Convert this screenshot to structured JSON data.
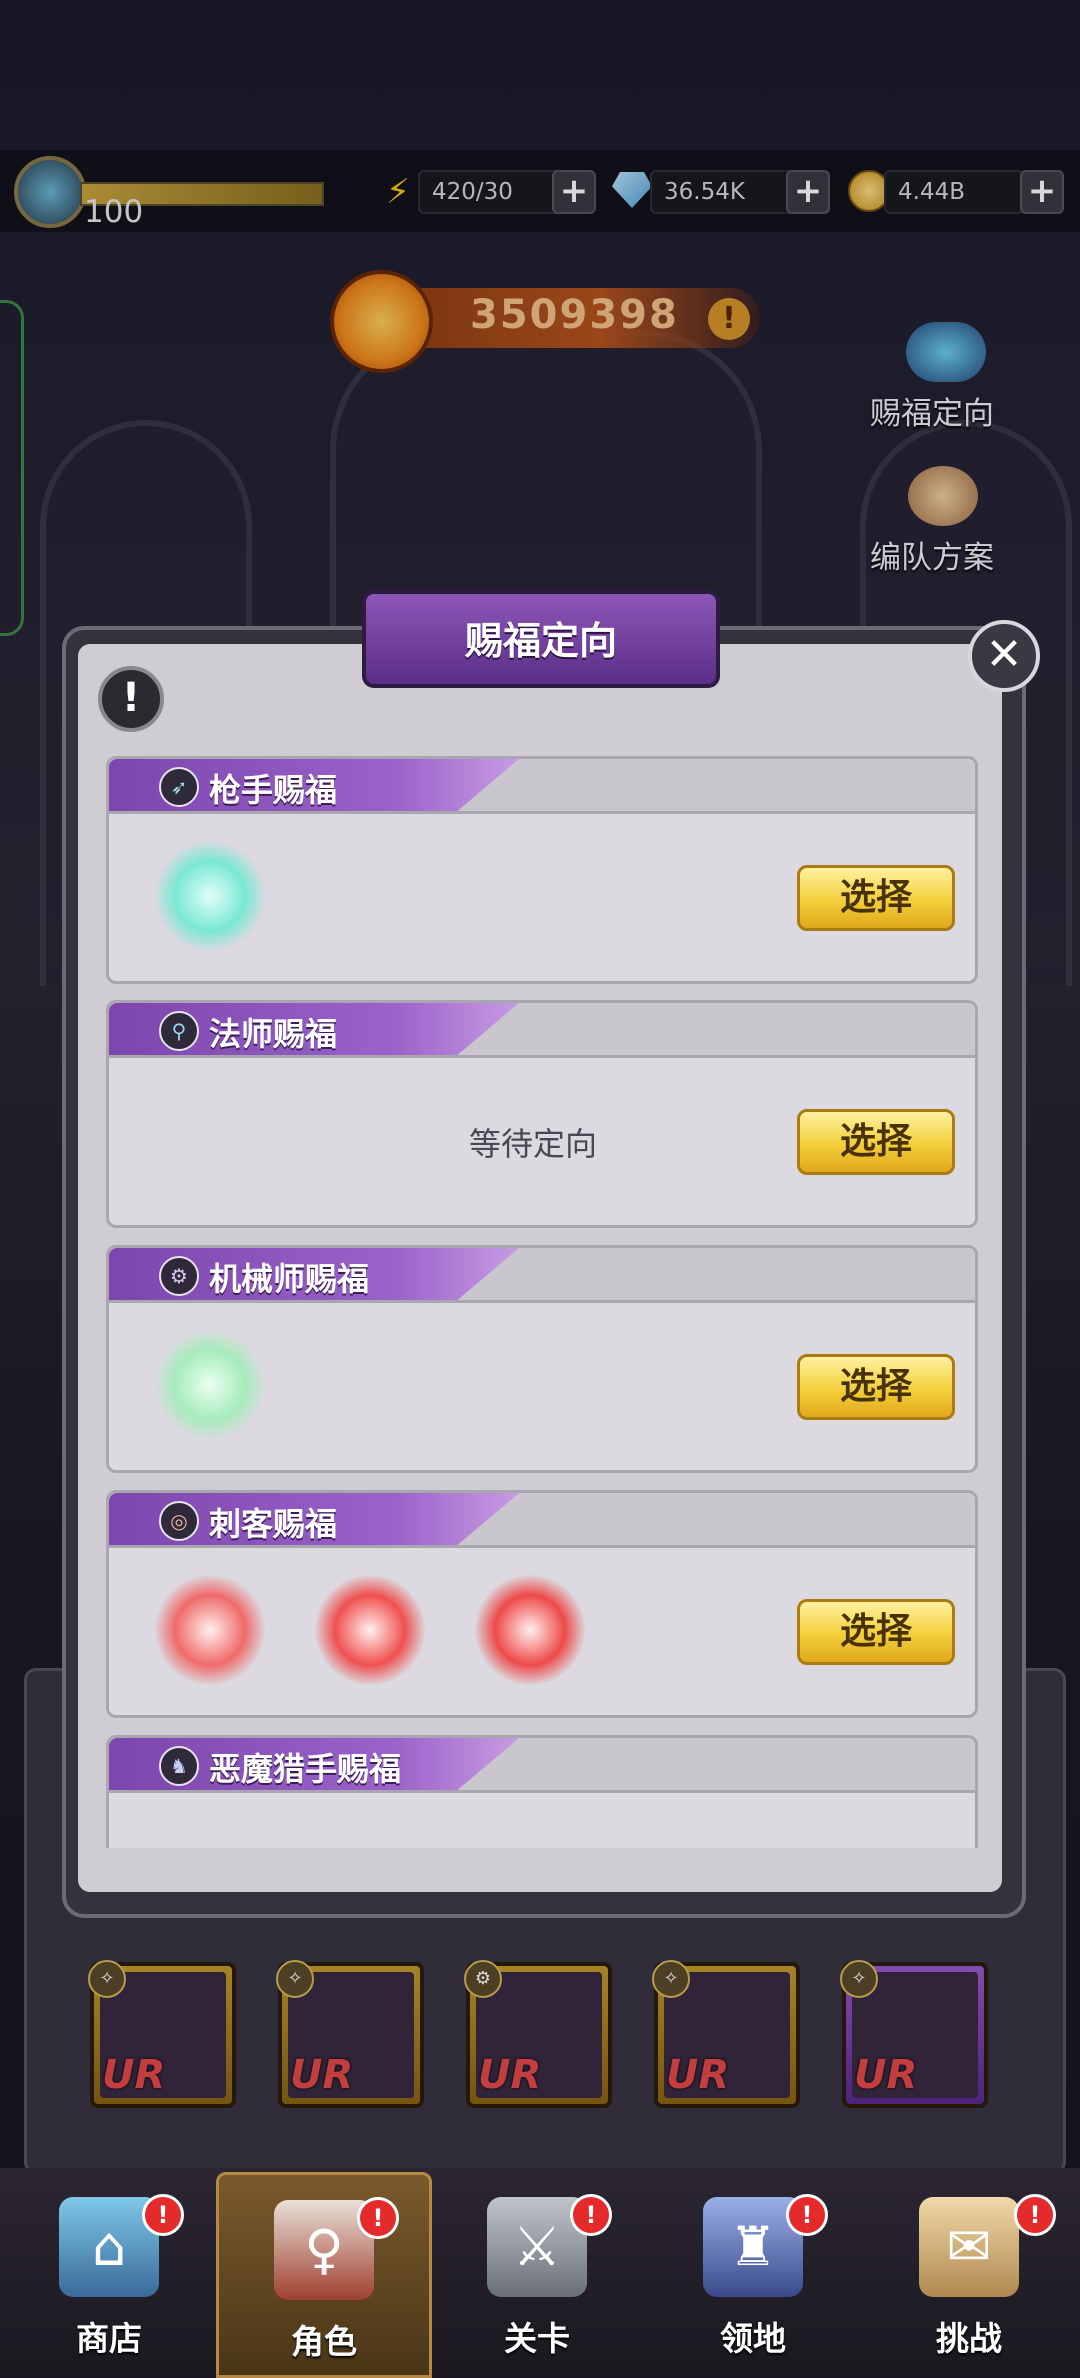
{
  "topbar": {
    "level": "100",
    "energy": "420/30",
    "gems": "36.54K",
    "gold": "4.44B",
    "plus_glyph": "+"
  },
  "power": {
    "value": "3509398",
    "info_glyph": "!"
  },
  "side": {
    "blessing_target": "赐福定向",
    "team_plan": "编队方案"
  },
  "dialog": {
    "title": "赐福定向",
    "close_glyph": "✕",
    "info_glyph": "!",
    "sections": [
      {
        "title": "枪手赐福",
        "icon": "gunner-icon",
        "select": "选择",
        "status": ""
      },
      {
        "title": "法师赐福",
        "icon": "mage-icon",
        "select": "选择",
        "status": "等待定向"
      },
      {
        "title": "机械师赐福",
        "icon": "mechanic-icon",
        "select": "选择",
        "status": ""
      },
      {
        "title": "刺客赐福",
        "icon": "assassin-icon",
        "select": "选择",
        "status": ""
      },
      {
        "title": "恶魔猎手赐福",
        "icon": "demon-hunter-icon",
        "select": "",
        "status": ""
      }
    ]
  },
  "heroes": {
    "rarity": "UR"
  },
  "nav": [
    {
      "label": "商店",
      "icon": "shop-icon"
    },
    {
      "label": "角色",
      "icon": "character-icon"
    },
    {
      "label": "关卡",
      "icon": "stage-icon"
    },
    {
      "label": "领地",
      "icon": "territory-icon"
    },
    {
      "label": "挑战",
      "icon": "challenge-icon"
    }
  ],
  "badge_glyph": "!",
  "colors": {
    "accent_purple": "#8d57b8",
    "button_gold": "#f3cf3a",
    "badge_red": "#e42a2a"
  }
}
